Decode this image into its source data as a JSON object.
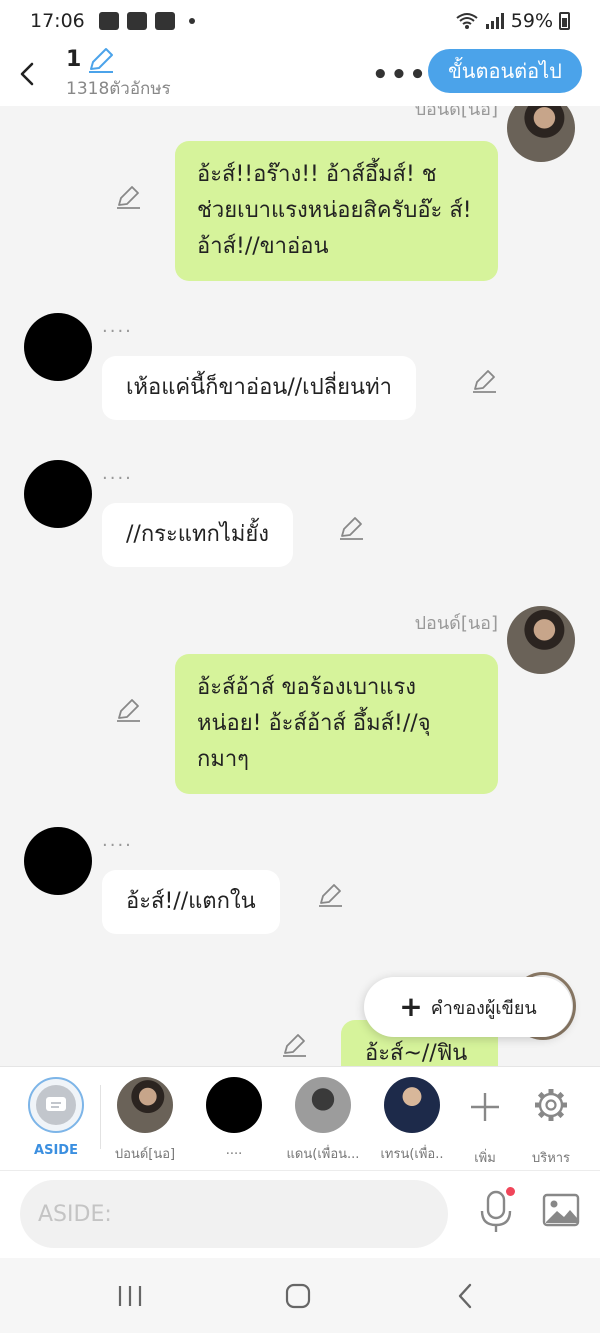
{
  "status_bar": {
    "time": "17:06",
    "battery": "59%"
  },
  "header": {
    "title": "1",
    "char_count": "1318ตัวอักษร",
    "more_label": "•••",
    "next_button": "ขั้นตอนต่อไป"
  },
  "messages": [
    {
      "side": "right",
      "sender": "ปอนด์[นอ]",
      "text": "อ้ะส์!!อร๊าง!! อ้าส์อึ้มส์! ช ช่วยเบาแรงหน่อยสิครับอ๊ะ ส์!อ้าส์!//ขาอ่อน"
    },
    {
      "side": "left",
      "sender": "....",
      "text": "เห้อแค่นี้ก็ขาอ่อน//เปลี่ยนท่า"
    },
    {
      "side": "left",
      "sender": "....",
      "text": "//กระแทกไม่ยั้ง"
    },
    {
      "side": "right",
      "sender": "ปอนด์[นอ]",
      "text": "อ้ะส์อ้าส์ ขอร้องเบาแรง หน่อย! อ้ะส์อ้าส์ อึ้มส์!//จุ กมาๆ"
    },
    {
      "side": "left",
      "sender": "....",
      "text": "อ้ะส์!//แตกใน"
    },
    {
      "side": "right",
      "sender": "",
      "text": "อ้ะส์~//ฟิน"
    }
  ],
  "fab": {
    "label": "คำของผู้เขียน",
    "icon": "plus-icon"
  },
  "characters": [
    {
      "label": "ASIDE"
    },
    {
      "label": "ปอนด์[นอ]"
    },
    {
      "label": "...."
    },
    {
      "label": "แดน(เพื่อน..."
    },
    {
      "label": "เทรน(เพื่อ.."
    },
    {
      "label": "เพิ่ม"
    },
    {
      "label": "บริหาร"
    }
  ],
  "input": {
    "placeholder": "ASIDE:"
  },
  "colors": {
    "accent": "#4ba3ea",
    "bubble_right": "#d6f39b",
    "bubble_left": "#ffffff"
  }
}
